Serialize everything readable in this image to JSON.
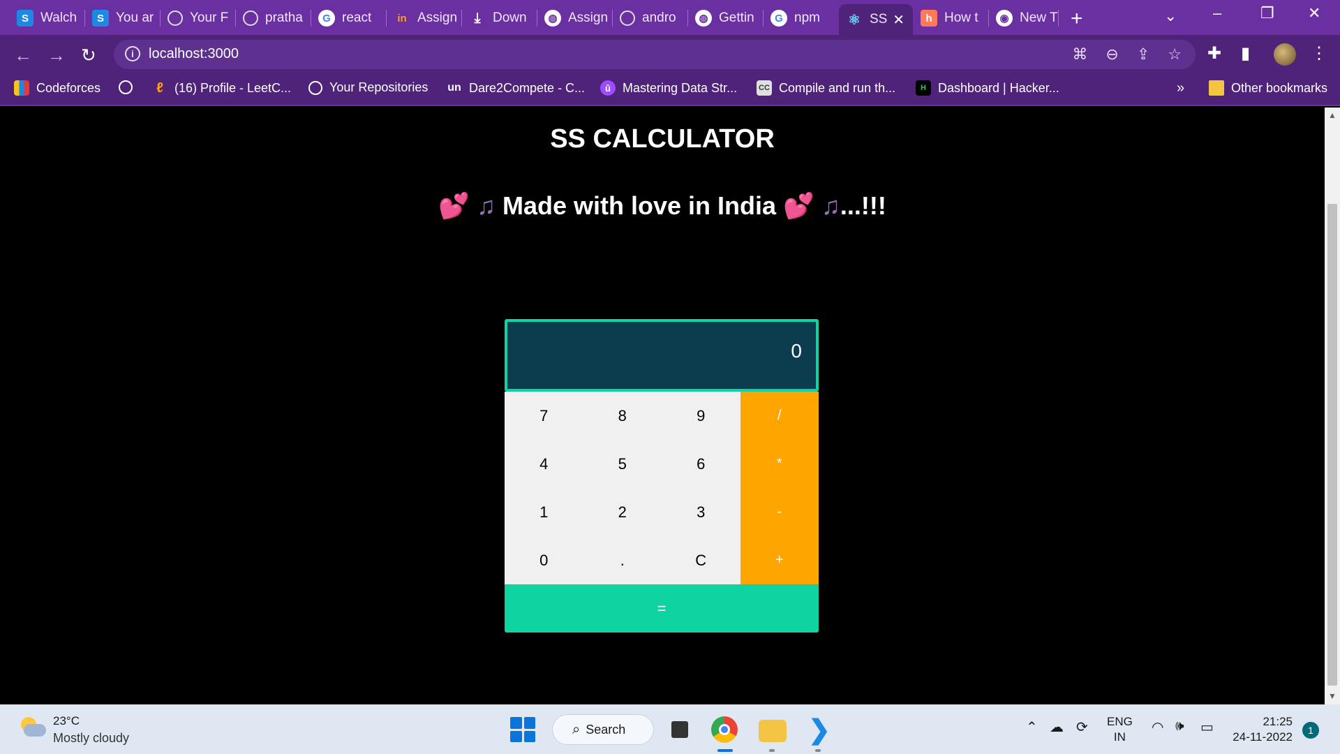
{
  "browser": {
    "tabs": [
      {
        "label": "Walch",
        "icon": "s-icon"
      },
      {
        "label": "You ar",
        "icon": "s-icon"
      },
      {
        "label": "Your F",
        "icon": "github-icon"
      },
      {
        "label": "pratha",
        "icon": "github-icon"
      },
      {
        "label": "react",
        "icon": "google-icon"
      },
      {
        "label": "Assign",
        "icon": "internshala-icon"
      },
      {
        "label": "Down",
        "icon": "download-icon"
      },
      {
        "label": "Assign",
        "icon": "globe-icon"
      },
      {
        "label": "andro",
        "icon": "github-icon"
      },
      {
        "label": "Gettin",
        "icon": "globe-icon"
      },
      {
        "label": "npm",
        "icon": "google-icon"
      },
      {
        "label": "SS",
        "icon": "react-icon",
        "active": true
      },
      {
        "label": "How t",
        "icon": "hubspot-icon"
      },
      {
        "label": "New T",
        "icon": "chrome-icon"
      }
    ],
    "url": "localhost:3000",
    "bookmarks": [
      {
        "label": "Codeforces",
        "icon": "codeforces-icon"
      },
      {
        "label": "",
        "icon": "github-icon"
      },
      {
        "label": "(16) Profile - LeetC...",
        "icon": "leetcode-icon"
      },
      {
        "label": "Your Repositories",
        "icon": "github-icon"
      },
      {
        "label": "Dare2Compete - C...",
        "icon": "unstop-icon"
      },
      {
        "label": "Mastering Data Str...",
        "icon": "course-icon"
      },
      {
        "label": "Compile and run th...",
        "icon": "cc-icon"
      },
      {
        "label": "Dashboard | Hacker...",
        "icon": "hackerrank-icon"
      }
    ],
    "overflow": "»",
    "other_bookmarks": "Other bookmarks"
  },
  "page": {
    "title": "SS CALCULATOR",
    "tagline_text": "Made with love in India",
    "tagline_suffix": "...!!!"
  },
  "calculator": {
    "display": "0",
    "keys": [
      "7",
      "8",
      "9",
      "/",
      "4",
      "5",
      "6",
      "*",
      "1",
      "2",
      "3",
      "-",
      "0",
      ".",
      "C",
      "+"
    ],
    "equals": "=",
    "colors": {
      "display_bg": "#0b3d4f",
      "accent": "#0fd3a0",
      "operator": "#ffa500",
      "key_bg": "#f0f0f0"
    }
  },
  "taskbar": {
    "weather_temp": "23°C",
    "weather_desc": "Mostly cloudy",
    "search_label": "Search",
    "lang_line1": "ENG",
    "lang_line2": "IN",
    "time": "21:25",
    "date": "24-11-2022",
    "notifications": "1"
  }
}
